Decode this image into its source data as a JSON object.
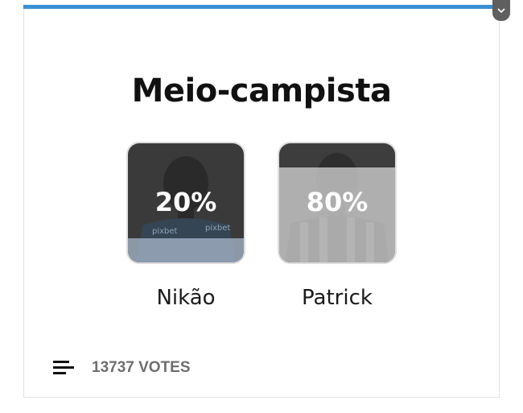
{
  "poll": {
    "title": "Meio-campista",
    "options": [
      {
        "name": "Nikão",
        "percent_label": "20%",
        "percent": 20
      },
      {
        "name": "Patrick",
        "percent_label": "80%",
        "percent": 80
      }
    ],
    "votes_label": "13737 VOTES"
  },
  "colors": {
    "accent": "#3b8fd4",
    "fill": "#a9b8cc",
    "overlay": "#4a4a4a"
  },
  "icons": {
    "corner": "chevron-down-icon",
    "stats": "bar-chart-icon"
  }
}
